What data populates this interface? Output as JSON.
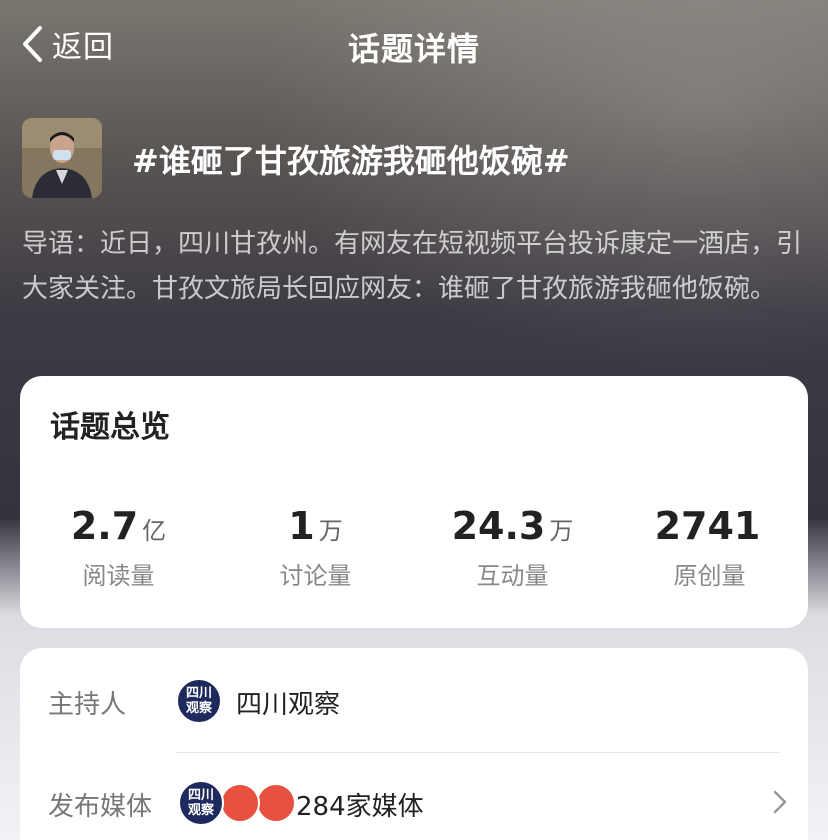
{
  "nav": {
    "back_label": "返回",
    "title": "话题详情"
  },
  "topic": {
    "title": "#谁砸了甘孜旅游我砸他饭碗#",
    "intro": "导语：近日，四川甘孜州。有网友在短视频平台投诉康定一酒店，引大家关注。甘孜文旅局长回应网友：谁砸了甘孜旅游我砸他饭碗。"
  },
  "overview": {
    "title": "话题总览",
    "stats": [
      {
        "value": "2.7",
        "unit": "亿",
        "label": "阅读量"
      },
      {
        "value": "1",
        "unit": "万",
        "label": "讨论量"
      },
      {
        "value": "24.3",
        "unit": "万",
        "label": "互动量"
      },
      {
        "value": "2741",
        "unit": "",
        "label": "原创量"
      }
    ]
  },
  "info": {
    "host_label": "主持人",
    "host_name": "四川观察",
    "host_logo_text": [
      "四川",
      "观察"
    ],
    "media_label": "发布媒体",
    "media_count": "284家媒体"
  },
  "colors": {
    "logo_navy": "#1e2a5e",
    "logo_red": "#e8503f"
  }
}
